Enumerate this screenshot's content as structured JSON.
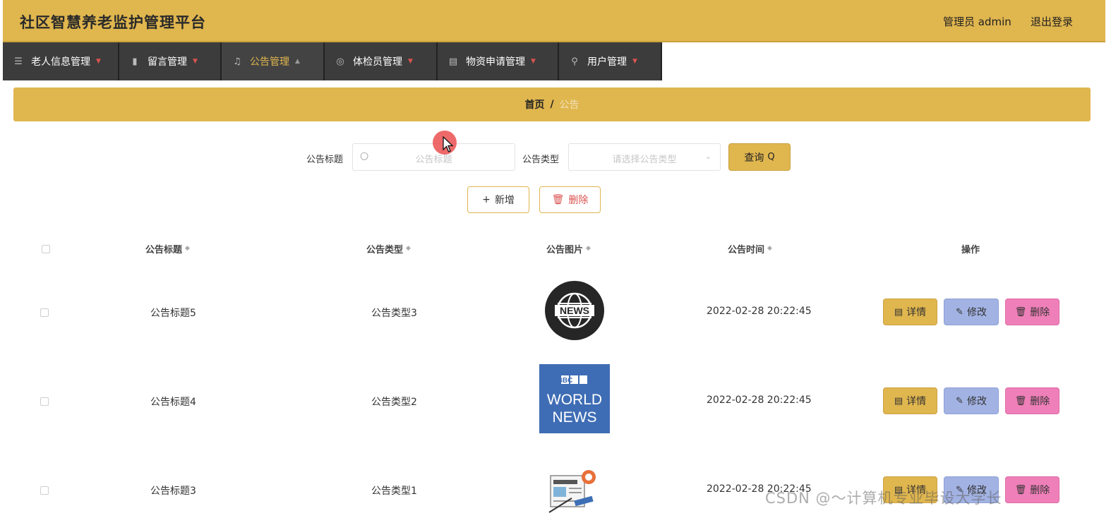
{
  "header": {
    "title": "社区智慧养老监护管理平台",
    "admin_label": "管理员 admin",
    "logout": "退出登录"
  },
  "nav": {
    "items": [
      {
        "label": "老人信息管理",
        "icon": "list-icon"
      },
      {
        "label": "留言管理",
        "icon": "bar-chart-icon"
      },
      {
        "label": "公告管理",
        "icon": "bell-icon"
      },
      {
        "label": "体检员管理",
        "icon": "user-circle-icon"
      },
      {
        "label": "物资申请管理",
        "icon": "document-icon"
      },
      {
        "label": "用户管理",
        "icon": "user-icon"
      }
    ],
    "active_index": 2,
    "active_color": "#e0b64e"
  },
  "breadcrumb": {
    "home": "首页",
    "separator": "/",
    "current": "公告"
  },
  "search": {
    "title_label": "公告标题",
    "title_placeholder": "公告标题",
    "type_label": "公告类型",
    "type_placeholder": "请选择公告类型",
    "query_button": "查询"
  },
  "actions": {
    "add_label": "新增",
    "delete_label": "删除"
  },
  "table": {
    "columns": [
      "公告标题",
      "公告类型",
      "公告图片",
      "公告时间",
      "操作"
    ],
    "rows": [
      {
        "title": "公告标题5",
        "type": "公告类型3",
        "image": "news-globe-icon",
        "time": "2022-02-28 20:22:45"
      },
      {
        "title": "公告标题4",
        "type": "公告类型2",
        "image": "bbc-world-news-logo",
        "image_text": [
          "BBC",
          "WORLD",
          "NEWS"
        ],
        "time": "2022-02-28 20:22:45"
      },
      {
        "title": "公告标题3",
        "type": "公告类型1",
        "image": "newspaper-illustration",
        "time": "2022-02-28 20:22:45"
      }
    ],
    "row_actions": {
      "detail": "详情",
      "edit": "修改",
      "delete": "删除"
    }
  },
  "colors": {
    "brand": "#e0b64e",
    "nav_bg": "#3c3c3c",
    "edit_button": "#a2b2e3",
    "delete_button": "#ef7fb8",
    "danger_text": "#d9534f"
  },
  "watermark": "CSDN @～计算机专业毕设大学长"
}
